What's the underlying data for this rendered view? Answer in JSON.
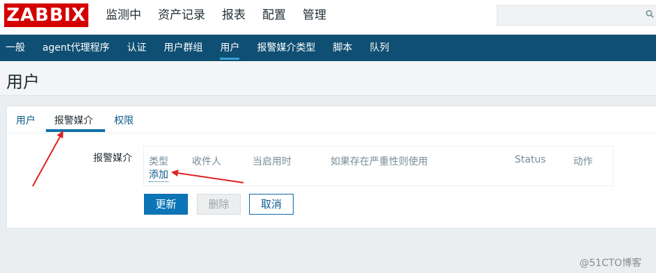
{
  "logo": "ZABBIX",
  "top_nav": [
    "监测中",
    "资产记录",
    "报表",
    "配置",
    "管理"
  ],
  "top_nav_active": "管理",
  "search": {
    "value": "",
    "placeholder": ""
  },
  "sub_nav": [
    "一般",
    "agent代理程序",
    "认证",
    "用户群组",
    "用户",
    "报警媒介类型",
    "脚本",
    "队列"
  ],
  "sub_nav_active": "用户",
  "page_title": "用户",
  "tabs": [
    "用户",
    "报警媒介",
    "权限"
  ],
  "active_tab": "报警媒介",
  "form": {
    "media_label": "报警媒介",
    "table_headers": [
      "类型",
      "收件人",
      "当启用时",
      "如果存在严重性则使用",
      "Status",
      "动作"
    ],
    "add_link": "添加"
  },
  "buttons": {
    "update": "更新",
    "delete": "删除",
    "cancel": "取消"
  },
  "watermark": "@51CTO博客",
  "colors": {
    "brand_red": "#d40000",
    "nav_dark": "#0f4f73",
    "link_blue": "#0b5a8c",
    "annotation_red": "#e02020"
  }
}
